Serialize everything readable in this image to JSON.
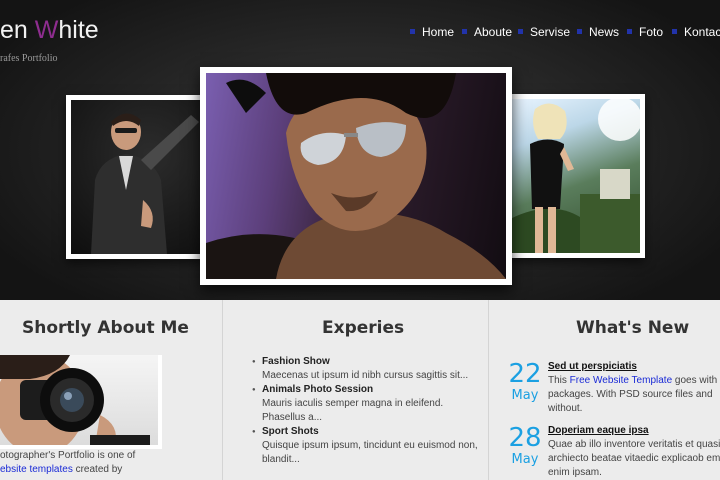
{
  "header": {
    "logo_part1": "en ",
    "logo_accent": "W",
    "logo_part2": "hite",
    "tagline": "rafes Portfolio"
  },
  "nav": {
    "items": [
      {
        "label": "Home"
      },
      {
        "label": "Aboute"
      },
      {
        "label": "Servise"
      },
      {
        "label": "News"
      },
      {
        "label": "Foto"
      },
      {
        "label": "Kontact"
      }
    ]
  },
  "about": {
    "heading": "Shortly About Me",
    "line1": "otographer's Portfolio is one of",
    "link": "ebsite templates",
    "line2_suffix": " created by"
  },
  "experience": {
    "heading": "Experies",
    "items": [
      {
        "title": "Fashion Show",
        "desc1": "Maecenas ut ipsum id nibh cursus sagittis sit...",
        "desc2": ""
      },
      {
        "title": "Animals Photo Session",
        "desc1": "Mauris iaculis semper magna in eleifend.",
        "desc2": "Phasellus a..."
      },
      {
        "title": "Sport Shots",
        "desc1": "Quisque ipsum ipsum, tincidunt eu euismod non,",
        "desc2": "blandit..."
      }
    ]
  },
  "news": {
    "heading": "What's New",
    "items": [
      {
        "day": "22",
        "month": "May",
        "title": "Sed ut perspiciatis",
        "l1_pre": "This ",
        "l1_link": "Free Website Template",
        "l1_post": " goes with",
        "l2": "packages. With PSD source files and",
        "l3": "without."
      },
      {
        "day": "28",
        "month": "May",
        "title": "Doperiam eaque ipsa",
        "l1_pre": "Quae ab illo inventore veritatis et quasi",
        "l1_link": "",
        "l1_post": "",
        "l2": "archiecto beatae vitaedic explicaob eme",
        "l3": "enim ipsam."
      }
    ]
  },
  "colors": {
    "accent_purple": "#8e2d8f",
    "nav_bullet": "#2233aa",
    "date_blue": "#1ba0e2",
    "link_blue": "#1a2ad6"
  }
}
